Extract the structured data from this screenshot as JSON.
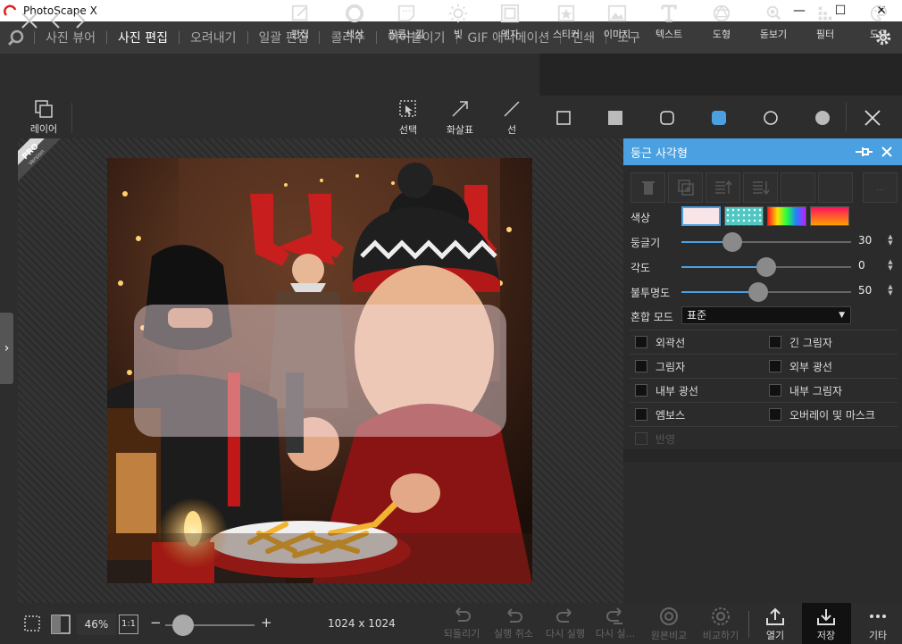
{
  "app": {
    "title": "PhotoScape X"
  },
  "window_controls": {
    "minimize": "—",
    "maximize": "☐",
    "close": "✕"
  },
  "menu": {
    "items": [
      "사진 뷰어",
      "사진 편집",
      "오려내기",
      "일괄 편집",
      "콜라주",
      "이어붙이기",
      "GIF 애니메이션",
      "인쇄",
      "도구"
    ],
    "active": "사진 편집"
  },
  "toolbar": {
    "tools": [
      "편집",
      "색상",
      "필름느낌",
      "빛",
      "액자",
      "스티커",
      "이미지",
      "텍스트",
      "도형",
      "돋보기",
      "필터",
      "도구"
    ]
  },
  "subtoolbar": {
    "layer": "레이어",
    "select": "선택",
    "arrow": "화살표",
    "line": "선"
  },
  "badge": {
    "pro": "PRO",
    "version": "Version"
  },
  "panel": {
    "title": "둥근 사각형",
    "color_label": "색상",
    "roundness_label": "둥글기",
    "roundness_value": "30",
    "roundness": 0.3,
    "angle_label": "각도",
    "angle_value": "0",
    "angle": 0.5,
    "opacity_label": "불투명도",
    "opacity_value": "50",
    "opacity": 0.45,
    "blend_label": "혼합 모드",
    "blend_value": "표준",
    "checkboxes": [
      "외곽선",
      "긴 그림자",
      "그림자",
      "외부 광선",
      "내부 광선",
      "내부 그림자",
      "엠보스",
      "오버레이 및 마스크"
    ],
    "disabled_option": "반영",
    "more": "..."
  },
  "bottom": {
    "zoom": "46%",
    "ratio": "1:1",
    "zoom_minus": "−",
    "zoom_plus": "+",
    "zoom_level": 0.2,
    "image_size": "1024 x 1024",
    "actions": [
      "되돌리기",
      "실행 취소",
      "다시 실행",
      "다시 실...",
      "원본비교",
      "비교하기"
    ],
    "open": "열기",
    "save": "저장",
    "more": "기타"
  },
  "colors": {
    "accent": "#4aa0e0",
    "swatch1": "#f9e4e8",
    "swatch2": "#4fc7c3"
  }
}
